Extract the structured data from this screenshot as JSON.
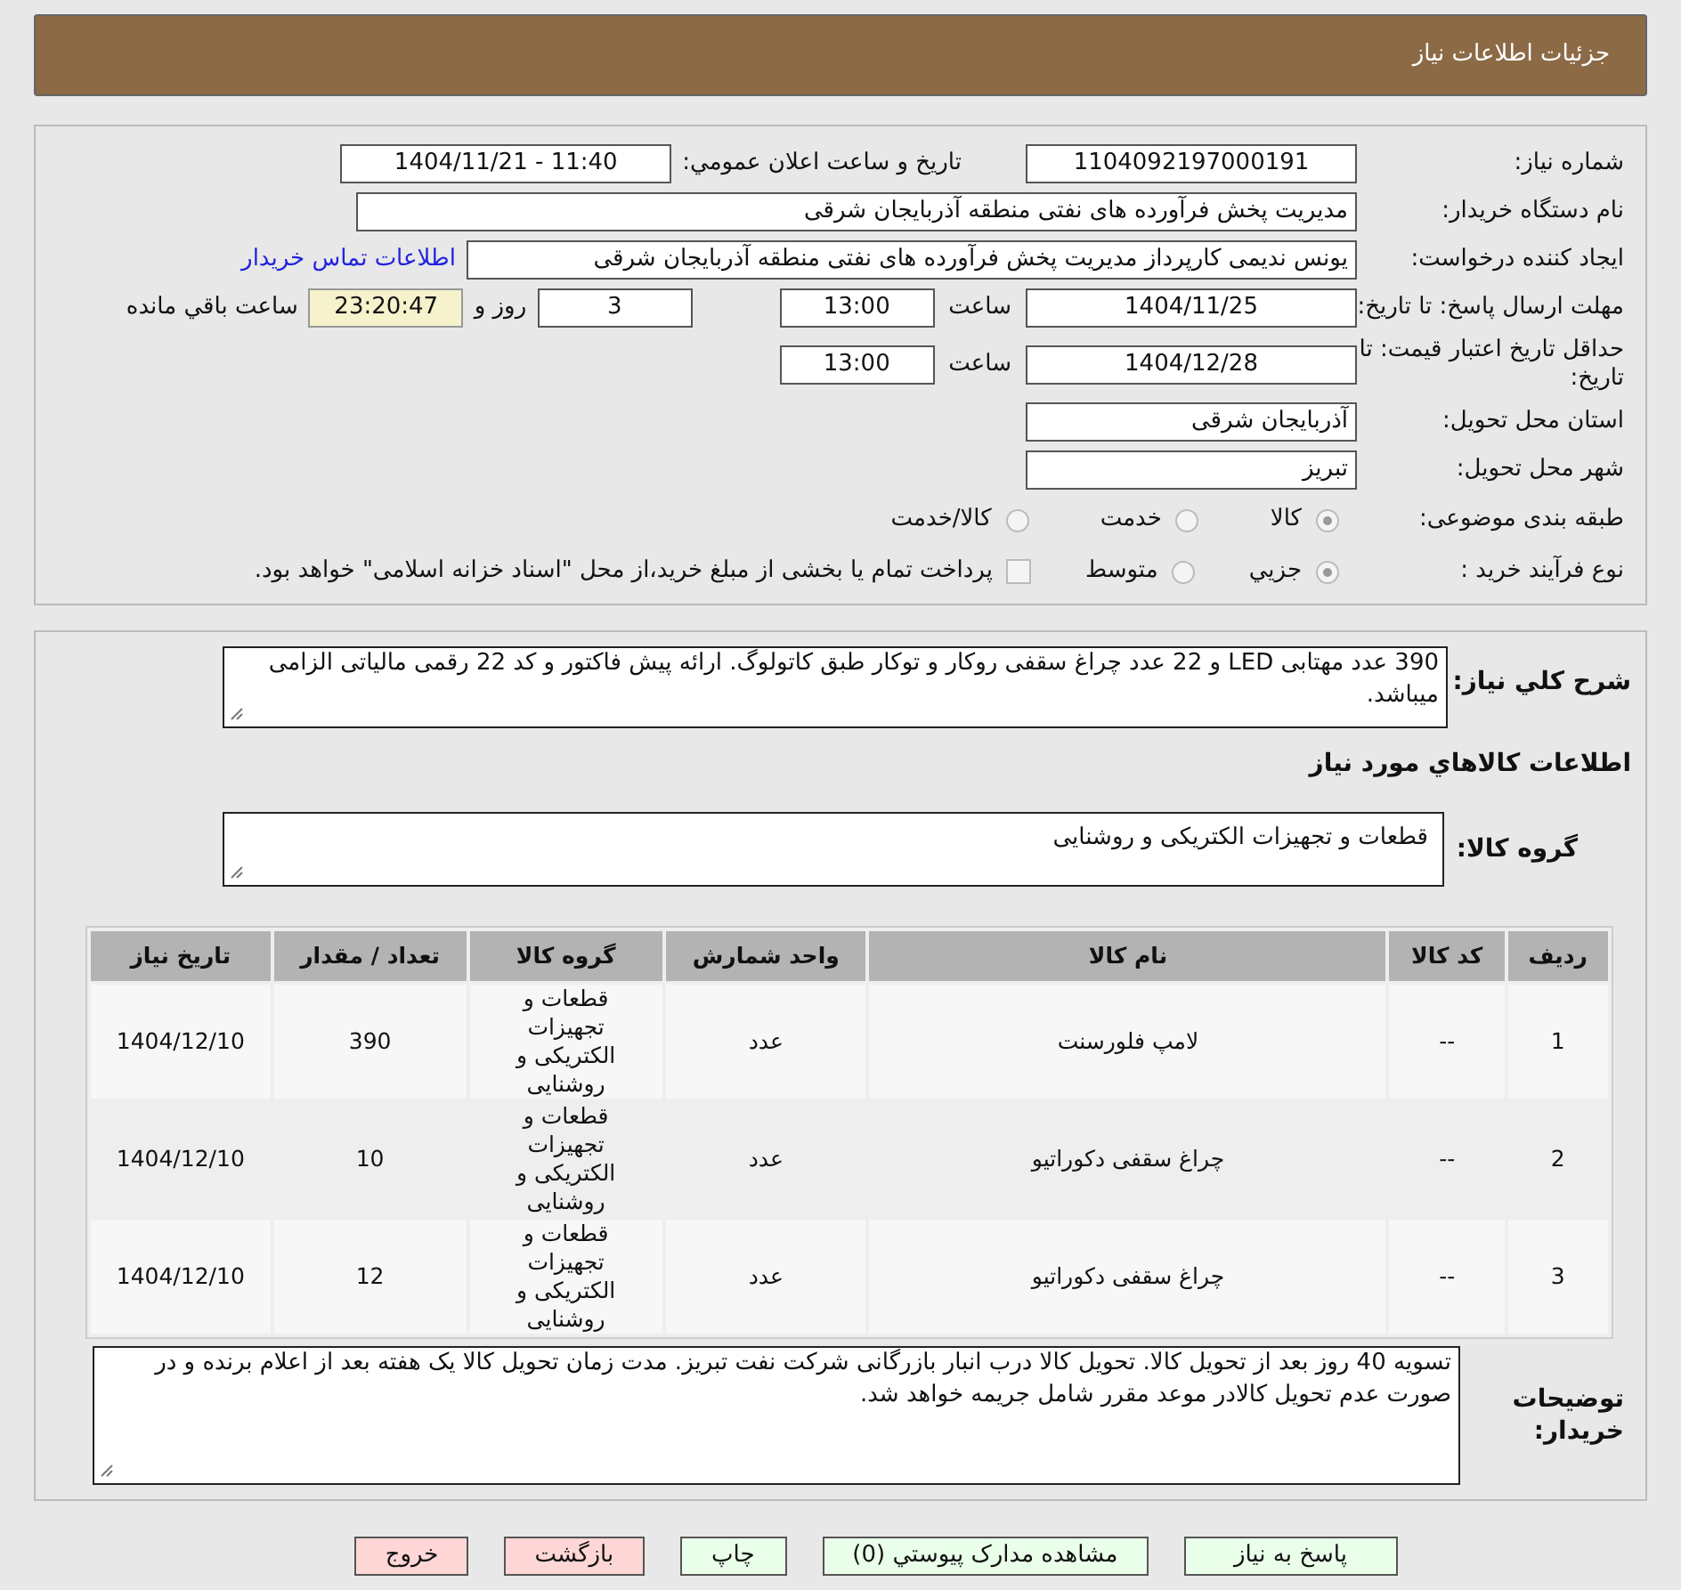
{
  "header": {
    "title": "جزئیات اطلاعات نیاز"
  },
  "need_number": {
    "label": "شماره نیاز:",
    "value": "1104092197000191"
  },
  "announce": {
    "label": "تاريخ و ساعت اعلان عمومي:",
    "value": "11:40 - 1404/11/21"
  },
  "buyer_org": {
    "label": "نام دستگاه خریدار:",
    "value": "مدیریت پخش فرآورده های نفتی منطقه آذربایجان شرقی"
  },
  "requester": {
    "label": "ایجاد کننده درخواست:",
    "value": "یونس ندیمی کارپرداز مدیریت پخش فرآورده های نفتی منطقه آذربایجان شرقی",
    "link": "اطلاعات تماس خریدار"
  },
  "deadline": {
    "label": "مهلت ارسال پاسخ: تا تاریخ:",
    "date": "1404/11/25",
    "time_label": "ساعت",
    "time": "13:00",
    "days": "3",
    "days_label": "روز و",
    "remaining": "23:20:47",
    "remaining_label": "ساعت باقي مانده"
  },
  "validity": {
    "label": "حداقل تاریخ اعتبار قیمت: تا تاریخ:",
    "date": "1404/12/28",
    "time_label": "ساعت",
    "time": "13:00"
  },
  "province": {
    "label": "استان محل تحویل:",
    "value": "آذربایجان شرقی"
  },
  "city": {
    "label": "شهر محل تحویل:",
    "value": "تبریز"
  },
  "category": {
    "label": "طبقه بندی موضوعی:",
    "options": [
      {
        "label": "کالا",
        "selected": true
      },
      {
        "label": "خدمت",
        "selected": false
      },
      {
        "label": "کالا/خدمت",
        "selected": false
      }
    ]
  },
  "purchase_type": {
    "label": "نوع فرآیند خرید :",
    "options": [
      {
        "label": "جزيي",
        "selected": true
      },
      {
        "label": "متوسط",
        "selected": false
      }
    ],
    "treasury": {
      "label": "پرداخت تمام یا بخشی از مبلغ خرید،از محل \"اسناد خزانه اسلامی\" خواهد بود.",
      "checked": false
    }
  },
  "description": {
    "label": "شرح کلي نیاز:",
    "value": "390 عدد مهتابی LED و 22 عدد چراغ سقفی روکار و توکار طبق کاتولوگ. ارائه پیش فاکتور و کد 22 رقمی مالیاتی الزامی میباشد."
  },
  "goods_heading": "اطلاعات کالاهاي مورد نیاز",
  "goods_group": {
    "label": "گروه کالا:",
    "value": "قطعات و تجهیزات الکتریکی و روشنایی"
  },
  "table": {
    "columns": [
      "ردیف",
      "کد کالا",
      "نام کالا",
      "واحد شمارش",
      "گروه کالا",
      "تعداد / مقدار",
      "تاریخ نیاز"
    ],
    "rows": [
      [
        "1",
        "--",
        "لامپ فلورسنت",
        "عدد",
        "قطعات و تجهیزات الکتریکی و روشنایی",
        "390",
        "1404/12/10"
      ],
      [
        "2",
        "--",
        "چراغ سقفی دکوراتیو",
        "عدد",
        "قطعات و تجهیزات الکتریکی و روشنایی",
        "10",
        "1404/12/10"
      ],
      [
        "3",
        "--",
        "چراغ سقفی دکوراتیو",
        "عدد",
        "قطعات و تجهیزات الکتریکی و روشنایی",
        "12",
        "1404/12/10"
      ]
    ]
  },
  "buyer_notes": {
    "label": "توضیحات خریدار:",
    "value": "تسویه 40 روز بعد از تحویل کالا. تحویل کالا درب انبار بازرگانی شرکت نفت تبریز. مدت زمان تحویل کالا یک هفته بعد از اعلام برنده و در صورت عدم تحویل کالادر موعد مقرر شامل جریمه خواهد شد."
  },
  "buttons": [
    {
      "label": "پاسخ به نیاز",
      "kind": "action"
    },
    {
      "label": "مشاهده مدارک پیوستي (0)",
      "kind": "action"
    },
    {
      "label": "چاپ",
      "kind": "action"
    },
    {
      "label": "بازگشت",
      "kind": "exit"
    },
    {
      "label": "خروج",
      "kind": "exit"
    }
  ]
}
